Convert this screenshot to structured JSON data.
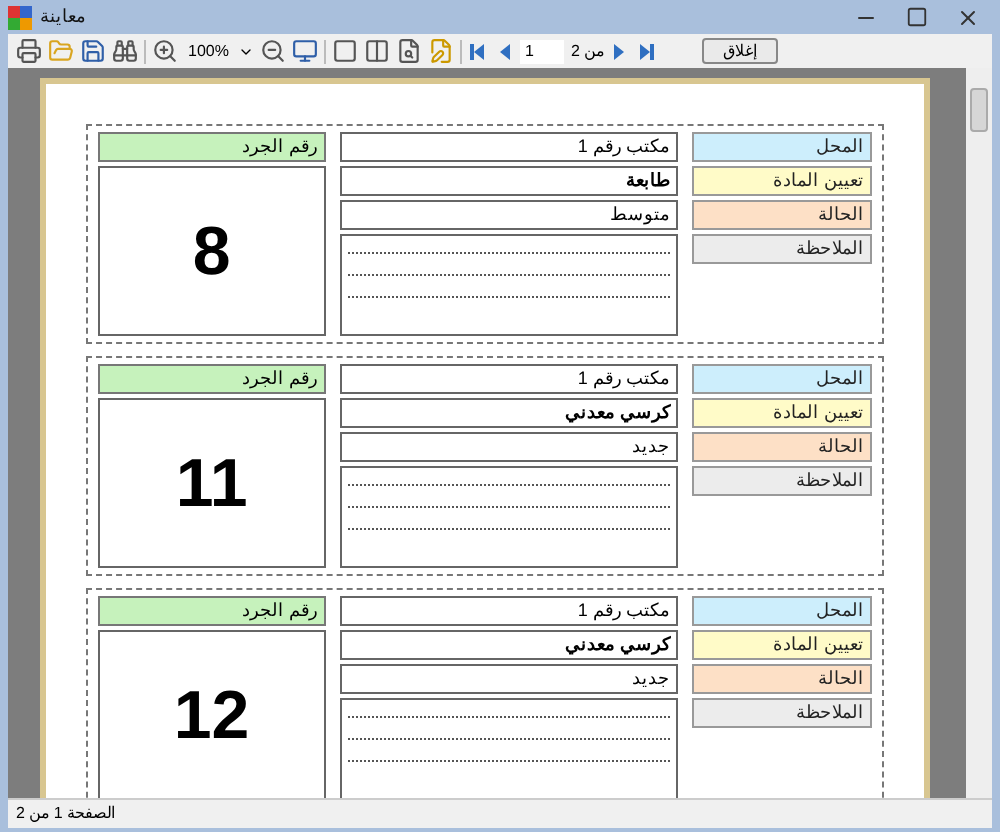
{
  "window": {
    "title": "معاينة"
  },
  "toolbar": {
    "zoom": "100%",
    "page": "1",
    "page_of": "من 2",
    "close_button": "إغلاق"
  },
  "cards": [
    {
      "id_label": "رقم الجرد",
      "id_number": "8",
      "fields": [
        {
          "kind": "text",
          "label": "المحل",
          "color": "#cdeefc",
          "value": "مكتب رقم 1",
          "bold": false
        },
        {
          "kind": "text",
          "label": "تعيين المادة",
          "color": "#fffbc8",
          "value": "طابعة",
          "bold": true
        },
        {
          "kind": "text",
          "label": "الحالة",
          "color": "#fde0c6",
          "value": "متوسط",
          "bold": false
        },
        {
          "kind": "notes",
          "label": "الملاحظة",
          "color": "#ececec"
        }
      ]
    },
    {
      "id_label": "رقم الجرد",
      "id_number": "11",
      "fields": [
        {
          "kind": "text",
          "label": "المحل",
          "color": "#cdeefc",
          "value": "مكتب رقم 1",
          "bold": false
        },
        {
          "kind": "text",
          "label": "تعيين المادة",
          "color": "#fffbc8",
          "value": "كرسي معدني",
          "bold": true
        },
        {
          "kind": "text",
          "label": "الحالة",
          "color": "#fde0c6",
          "value": "جديد",
          "bold": false
        },
        {
          "kind": "notes",
          "label": "الملاحظة",
          "color": "#ececec"
        }
      ]
    },
    {
      "id_label": "رقم الجرد",
      "id_number": "12",
      "fields": [
        {
          "kind": "text",
          "label": "المحل",
          "color": "#cdeefc",
          "value": "مكتب رقم 1",
          "bold": false
        },
        {
          "kind": "text",
          "label": "تعيين المادة",
          "color": "#fffbc8",
          "value": "كرسي معدني",
          "bold": true
        },
        {
          "kind": "text",
          "label": "الحالة",
          "color": "#fde0c6",
          "value": "جديد",
          "bold": false
        },
        {
          "kind": "notes",
          "label": "الملاحظة",
          "color": "#ececec"
        }
      ]
    }
  ],
  "status_bar": "الصفحة 1 من 2"
}
